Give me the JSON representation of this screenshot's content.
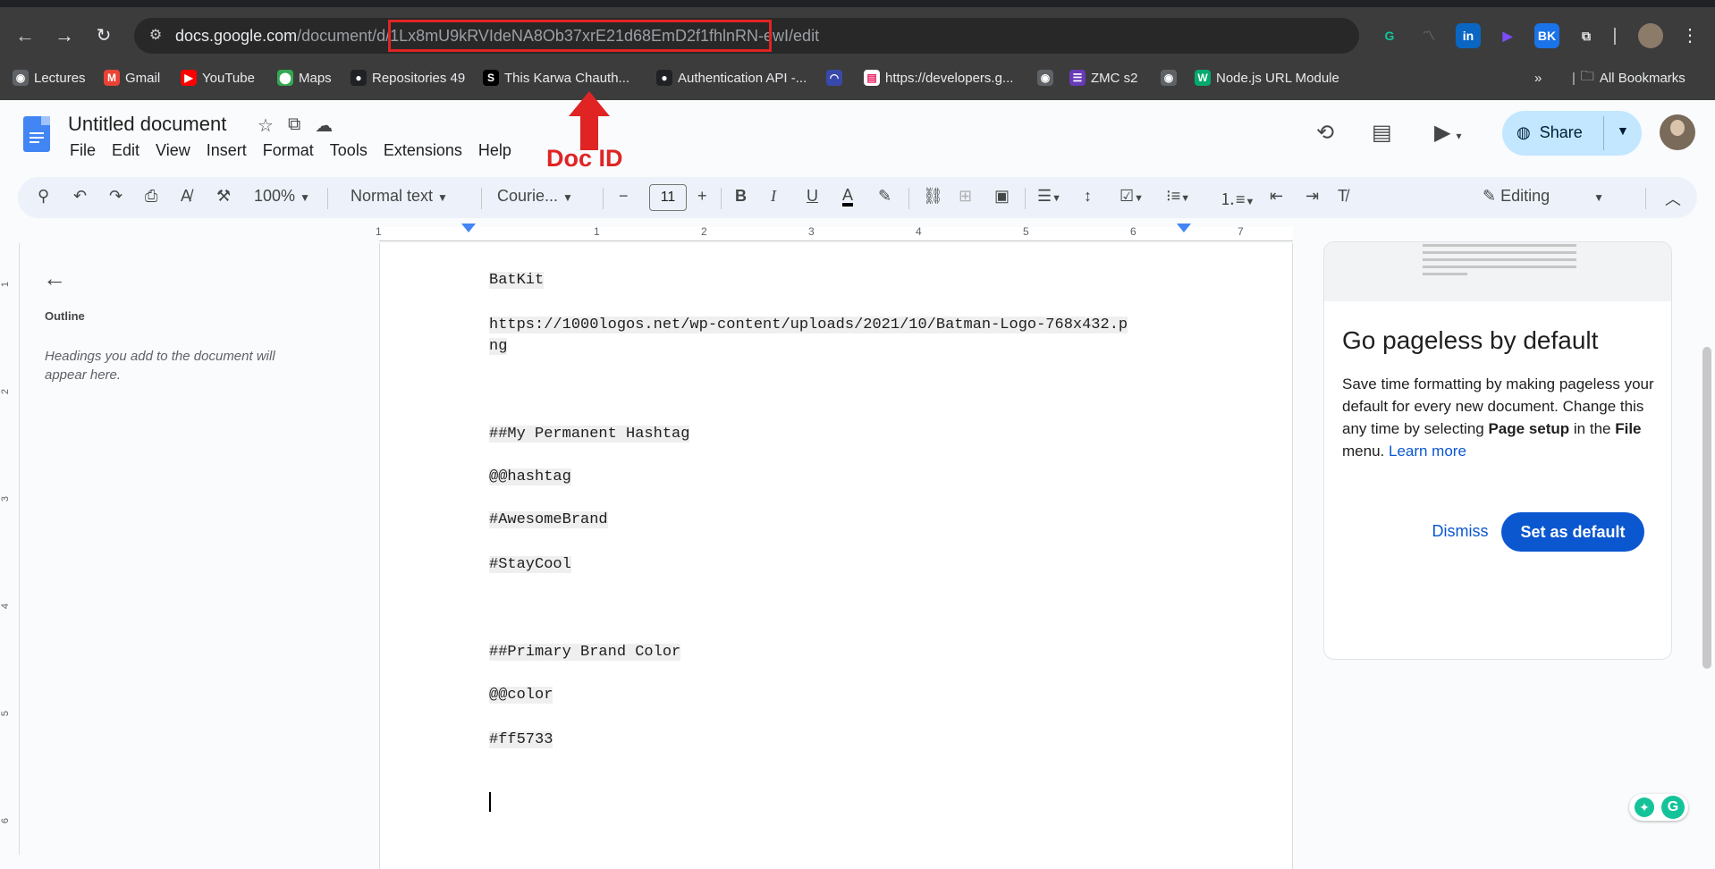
{
  "browser": {
    "url_host": "docs.google.com",
    "url_path": "/document/d/1Lx8mU9kRVIdeNA8Ob37xrE21d68EmD2f1fhlnRN-ewI/edit",
    "url_path_prefix": "/document/d/",
    "url_doc_id": "1Lx8mU9kRVIdeNA8Ob37xrE21d68EmD2f1fhlnRN-ewI",
    "url_path_suffix": "/edit",
    "extensions": [
      {
        "name": "grammarly-icon",
        "glyph": "G",
        "color": "#15c39a"
      },
      {
        "name": "analytics-icon",
        "glyph": "〽",
        "color": "#5f6368"
      },
      {
        "name": "linkedin-icon",
        "glyph": "in",
        "color": "#0a66c2"
      },
      {
        "name": "play-icon",
        "glyph": "▶",
        "color": "#7c4dff"
      },
      {
        "name": "bk-icon",
        "glyph": "BK",
        "color": "#1a73e8"
      },
      {
        "name": "puzzle-icon",
        "glyph": "⧉",
        "color": "#3c3c3c"
      }
    ],
    "bookmarks": [
      {
        "label": "Lectures",
        "icon": "globe-icon",
        "color": "#5f6368",
        "glyph": "◉"
      },
      {
        "label": "Gmail",
        "icon": "gmail-icon",
        "color": "#ea4335",
        "glyph": "M"
      },
      {
        "label": "YouTube",
        "icon": "youtube-icon",
        "color": "#ff0000",
        "glyph": "▶"
      },
      {
        "label": "Maps",
        "icon": "maps-icon",
        "color": "#34a853",
        "glyph": "⬤"
      },
      {
        "label": "Repositories 49",
        "icon": "github-icon",
        "color": "#202124",
        "glyph": "●"
      },
      {
        "label": "This Karwa Chauth...",
        "icon": "s-icon",
        "color": "#000000",
        "glyph": "S"
      },
      {
        "label": "Authentication API -...",
        "icon": "github-icon",
        "color": "#202124",
        "glyph": "●"
      },
      {
        "label": "",
        "icon": "dashboard-icon",
        "color": "#3949ab",
        "glyph": "◠"
      },
      {
        "label": "https://developers.g...",
        "icon": "bookmark-doc-icon",
        "color": "#ffffff",
        "glyph": "▤"
      },
      {
        "label": "",
        "icon": "globe-icon",
        "color": "#5f6368",
        "glyph": "◉"
      },
      {
        "label": "ZMC s2",
        "icon": "zmc-icon",
        "color": "#673ab7",
        "glyph": "☰"
      },
      {
        "label": "",
        "icon": "globe-icon",
        "color": "#5f6368",
        "glyph": "◉"
      },
      {
        "label": "Node.js URL Module",
        "icon": "w3-icon",
        "color": "#04aa6d",
        "glyph": "W"
      }
    ],
    "all_bookmarks": "All Bookmarks"
  },
  "annotation": {
    "label": "Doc ID",
    "color": "#e02424"
  },
  "docs": {
    "title": "Untitled document",
    "menus": [
      "File",
      "Edit",
      "View",
      "Insert",
      "Format",
      "Tools",
      "Extensions",
      "Help"
    ],
    "share_label": "Share",
    "toolbar": {
      "zoom": "100%",
      "style": "Normal text",
      "font": "Courie...",
      "font_size": "11",
      "mode": "Editing"
    },
    "ruler_numbers": [
      "1",
      "1",
      "2",
      "3",
      "4",
      "5",
      "6",
      "7"
    ],
    "vruler_numbers": [
      "1",
      "2",
      "3",
      "4",
      "5",
      "6"
    ]
  },
  "outline": {
    "title": "Outline",
    "hint": "Headings you add to the document will appear here."
  },
  "document": {
    "lines": [
      "BatKit",
      "https://1000logos.net/wp-content/uploads/2021/10/Batman-Logo-768x432.p",
      "ng",
      "##My Permanent Hashtag",
      "@@hashtag",
      "#AwesomeBrand",
      "#StayCool",
      "##Primary Brand Color",
      "@@color",
      "#ff5733"
    ]
  },
  "pageless_card": {
    "title": "Go pageless by default",
    "body_1": "Save time formatting by making pageless your default for every new document. Change this any time by selecting ",
    "body_bold_1": "Page setup",
    "body_2": " in the ",
    "body_bold_2": "File",
    "body_3": " menu. ",
    "link": "Learn more",
    "dismiss": "Dismiss",
    "set_default": "Set as default"
  }
}
